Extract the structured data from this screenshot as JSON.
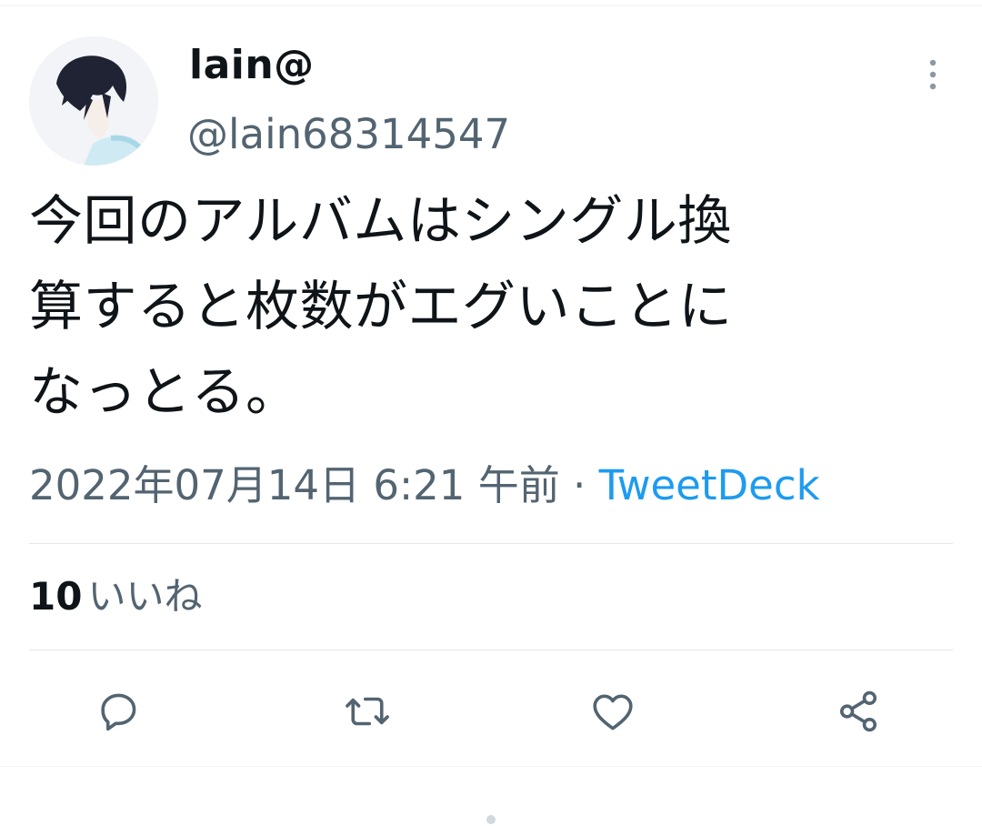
{
  "author": {
    "display_name": "lain@",
    "handle": "@lain68314547",
    "avatar_icon": "user-avatar-illustration"
  },
  "tweet": {
    "text_lines": [
      "今回のアルバムはシングル換",
      "算すると枚数がエグいことに",
      "なっとる。"
    ],
    "timestamp": "2022年07月14日 6:21 午前",
    "separator": "·",
    "source": "TweetDeck"
  },
  "stats": {
    "likes_count": "10",
    "likes_label": "いいね"
  },
  "actions": [
    {
      "icon": "reply-icon"
    },
    {
      "icon": "retweet-icon"
    },
    {
      "icon": "like-icon"
    },
    {
      "icon": "share-icon"
    }
  ],
  "colors": {
    "text_primary": "#0f1419",
    "text_secondary": "#536471",
    "link": "#1d9bf0",
    "divider": "#e3e7ea"
  }
}
